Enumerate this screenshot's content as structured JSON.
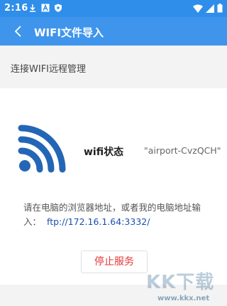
{
  "status_bar": {
    "time": "2:16",
    "icons": [
      "download-icon",
      "text-a-icon",
      "shield-icon"
    ],
    "right_icons": [
      "wifi-icon",
      "signal-icon",
      "battery-icon"
    ]
  },
  "app_bar": {
    "back_icon": "chevron-left-icon",
    "title": "WIFI文件导入"
  },
  "section": {
    "label": "连接WIFI远程管理"
  },
  "wifi_status": {
    "icon": "wifi-icon",
    "label": "wifi状态",
    "value": "\"airport-CvzQCH\""
  },
  "instruction": {
    "text": "请在电脑的浏览器地址，或者我的电脑地址输入：",
    "url": "ftp://172.16.1.64:3332/"
  },
  "actions": {
    "stop_label": "停止服务"
  },
  "watermark": {
    "text": "KK下载",
    "url": "www.kkx.net"
  },
  "colors": {
    "primary": "#3f95ec",
    "wifi_icon": "#2466b6",
    "stop_text": "#e53935",
    "link": "#1a4fb0"
  }
}
